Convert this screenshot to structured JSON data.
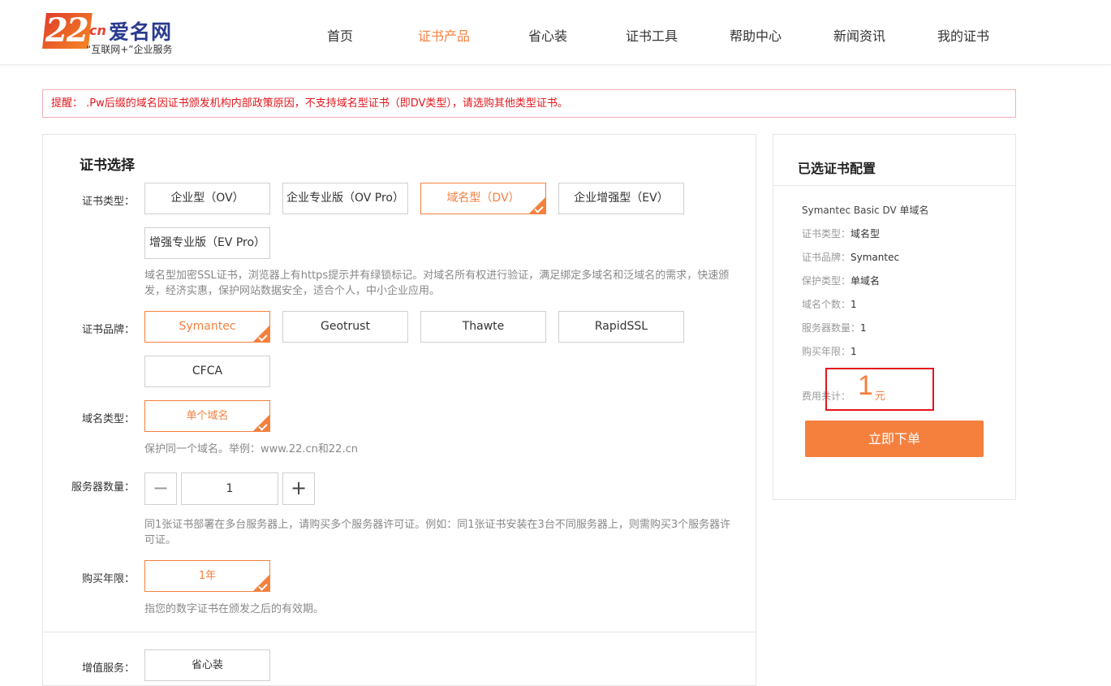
{
  "header": {
    "logo": {
      "number": "22",
      "domain_suffix": "cn",
      "brand": "爱名网",
      "slogan": "“互联网+”企业服务"
    },
    "nav": [
      "首页",
      "证书产品",
      "省心装",
      "证书工具",
      "帮助中心",
      "新闻资讯",
      "我的证书"
    ],
    "active_nav": "证书产品"
  },
  "notice": "提醒： .Pw后缀的域名因证书颁发机构内部政策原因，不支持域名型证书（即DV类型），请选购其他类型证书。",
  "form": {
    "title": "证书选择",
    "cert_type": {
      "label": "证书类型：",
      "options": [
        "企业型（OV）",
        "企业专业版（OV Pro）",
        "域名型（DV）",
        "企业增强型（EV）",
        "增强专业版（EV Pro）"
      ],
      "selected": "域名型（DV）",
      "description": "域名型加密SSL证书，浏览器上有https提示并有绿锁标记。对域名所有权进行验证，满足绑定多域名和泛域名的需求，快速颁发，经济实惠，保护网站数据安全，适合个人，中小企业应用。"
    },
    "brand": {
      "label": "证书品牌：",
      "options": [
        "Symantec",
        "Geotrust",
        "Thawte",
        "RapidSSL",
        "CFCA"
      ],
      "selected": "Symantec"
    },
    "domain_type": {
      "label": "域名类型：",
      "options": [
        "单个域名"
      ],
      "selected": "单个域名",
      "description": "保护同一个域名。举例：www.22.cn和22.cn"
    },
    "server_count": {
      "label": "服务器数量：",
      "minus": "−",
      "plus": "+",
      "value": "1",
      "description": "同1张证书部署在多台服务器上，请购买多个服务器许可证。例如：同1张证书安装在3台不同服务器上，则需购买3个服务器许可证。"
    },
    "years": {
      "label": "购买年限：",
      "options": [
        "1年"
      ],
      "selected": "1年",
      "description": "指您的数字证书在颁发之后的有效期。"
    },
    "value_added": {
      "label": "增值服务：",
      "options": [
        "省心装"
      ]
    }
  },
  "summary": {
    "title": "已选证书配置",
    "product": "Symantec Basic DV 单域名",
    "rows": [
      {
        "key": "证书类型：",
        "value": "域名型"
      },
      {
        "key": "证书品牌：",
        "value": "Symantec"
      },
      {
        "key": "保护类型：",
        "value": "单域名"
      },
      {
        "key": "域名个数：",
        "value": "1"
      },
      {
        "key": "服务器数量：",
        "value": "1"
      },
      {
        "key": "购买年限：",
        "value": "1"
      }
    ],
    "fee_label": "费用共计：",
    "fee_value": "1",
    "fee_unit": "元",
    "order_button": "立即下单"
  },
  "colors": {
    "accent": "#f5803e",
    "alert": "#e5151c",
    "brand_blue": "#2a3b8f"
  }
}
